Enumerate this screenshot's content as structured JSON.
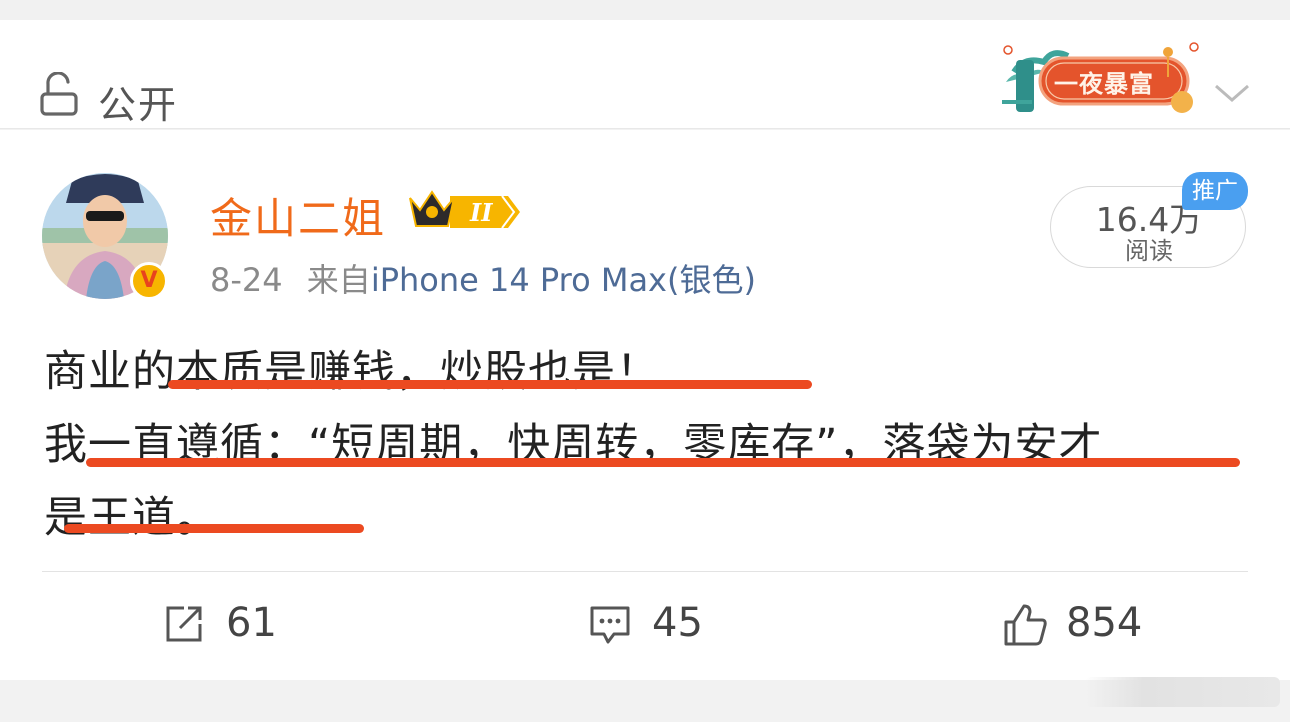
{
  "visibility": {
    "label": "公开",
    "icon": "lock-open-icon"
  },
  "badge": {
    "text": "一夜暴富"
  },
  "post": {
    "author": "金山二姐",
    "date": "8-24",
    "source_prefix": "来自",
    "device": "iPhone 14 Pro Max(银色)",
    "reads_count": "16.4万",
    "reads_label": "阅读",
    "promo_tag": "推广",
    "verified_badge": "V",
    "lines": [
      "商业的本质是赚钱，炒股也是！",
      "我一直遵循：“短周期，快周转，零库存”，落袋为安才",
      "是王道。"
    ]
  },
  "actions": {
    "reposts": "61",
    "comments": "45",
    "likes": "854"
  },
  "colors": {
    "author": "#f06a1a",
    "underline": "#ec4a21",
    "device_link": "#4e6b96",
    "promo": "#4a9ff0"
  }
}
